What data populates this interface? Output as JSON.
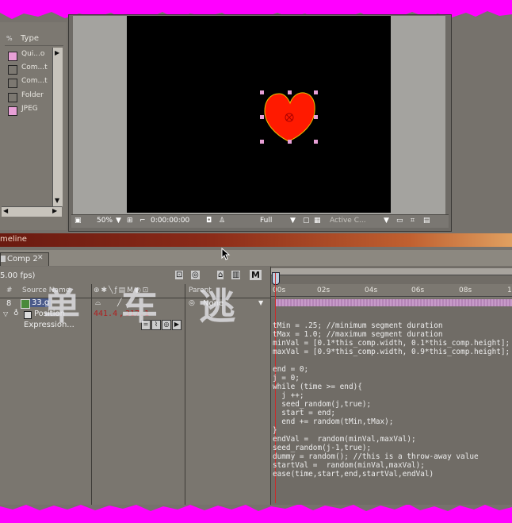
{
  "project": {
    "type_header": "Type",
    "items": [
      {
        "label": "Qui...o",
        "swatch": "#e7a0d6"
      },
      {
        "label": "Com...t",
        "swatch": "#7c7871"
      },
      {
        "label": "Com...t",
        "swatch": "#7c7871"
      },
      {
        "label": "Folder",
        "swatch": "#7c7871"
      },
      {
        "label": "JPEG",
        "swatch": "#e7a0d6"
      }
    ]
  },
  "comp_viewer": {
    "zoom": "50%",
    "timecode": "0:00:00:00",
    "resolution": "Full",
    "camera": "Active C...",
    "shape_color": "#ff1a00"
  },
  "timeline": {
    "panel_title": "meline",
    "tab_label": "Comp 2",
    "fps": "5.00 fps)",
    "columns": {
      "number": "#",
      "source_name": "Source Name",
      "parent": "Parent"
    },
    "layer": {
      "number": "8",
      "name": "33.g",
      "parent": "None"
    },
    "property": {
      "name": "Position",
      "value_x": "441.4",
      "value_sep": ",",
      "value_y": "317.1"
    },
    "expression_label": "Expression...",
    "ruler_ticks": [
      "00s",
      "02s",
      "04s",
      "06s",
      "08s",
      "1"
    ],
    "toolbar_m": "M"
  },
  "expression_lines": [
    "tMin = .25; //minimum segment duration",
    "tMax = 1.0; //maximum segment duration",
    "minVal = [0.1*this_comp.width, 0.1*this_comp.height];",
    "maxVal = [0.9*this_comp.width, 0.9*this_comp.height];",
    "",
    "end = 0;",
    "j = 0;",
    "while (time >= end){",
    "  j ++;",
    "  seed_random(j,true);",
    "  start = end;",
    "  end += random(tMin,tMax);",
    "}",
    "endVal =  random(minVal,maxVal);",
    "seed_random(j-1,true);",
    "dummy = random(); //this is a throw-away value",
    "startVal =  random(minVal,maxVal);",
    "ease(time,start,end,startVal,endVal)"
  ],
  "watermark": "单 车 逃",
  "colors": {
    "frame": "#ff00ff",
    "layer_bar": "#c79bc9",
    "cti": "#cc2a2a"
  }
}
